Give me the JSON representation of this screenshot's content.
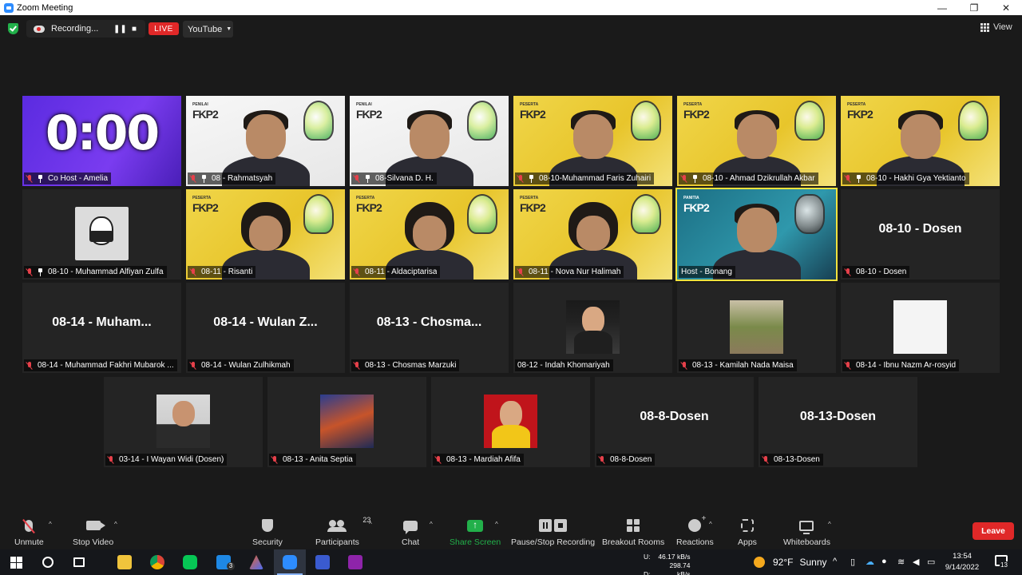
{
  "window": {
    "title": "Zoom Meeting",
    "controls": [
      "—",
      "❐",
      "✕"
    ]
  },
  "recording_bar": {
    "status": "Recording...",
    "live_label": "LIVE",
    "stream_target": "YouTube",
    "view_label": "View"
  },
  "timer": {
    "display": "0:00"
  },
  "tiles": [
    {
      "name": "Co Host - Amelia",
      "kind": "timer",
      "pinned": true
    },
    {
      "name": "08 - Rahmatsyah",
      "kind": "video",
      "bg": "white",
      "brand_top": "PENILAI",
      "pinned": true
    },
    {
      "name": "08-Silvana D. H.",
      "kind": "video",
      "bg": "white",
      "brand_top": "PENILAI",
      "pinned": true
    },
    {
      "name": "08-10-Muhammad Faris Zuhairi",
      "kind": "video",
      "bg": "yellow",
      "brand_top": "PESERTA",
      "pinned": true
    },
    {
      "name": "08-10 - Ahmad Dzikrullah Akbar",
      "kind": "video",
      "bg": "yellow",
      "brand_top": "PESERTA",
      "pinned": true
    },
    {
      "name": "08-10 - Hakhi Gya Yektianto",
      "kind": "video",
      "bg": "yellow",
      "brand_top": "PESERTA",
      "pinned": true
    },
    {
      "name": "08-10 - Muhammad Alfiyan Zulfa",
      "kind": "avatar",
      "pinned": true
    },
    {
      "name": "08-11 - Risanti",
      "kind": "video",
      "bg": "yellow",
      "brand_top": "PESERTA",
      "hijab": true
    },
    {
      "name": "08-11 - Aldaciptarisa",
      "kind": "video",
      "bg": "yellow",
      "brand_top": "PESERTA",
      "hijab": true
    },
    {
      "name": "08-11 - Nova Nur Halimah",
      "kind": "video",
      "bg": "yellow",
      "brand_top": "PESERTA",
      "hijab": true
    },
    {
      "name": "Host - Bonang",
      "kind": "video",
      "bg": "teal",
      "brand_top": "PANITIA",
      "highlight": true,
      "muted": false
    },
    {
      "name": "08-10 - Dosen",
      "kind": "text",
      "big": "08-10 - Dosen"
    },
    {
      "name": "08-14 - Muhammad Fakhri Mubarok ...",
      "kind": "text",
      "big": "08-14 - Muham..."
    },
    {
      "name": "08-14 - Wulan Zulhikmah",
      "kind": "text",
      "big": "08-14 - Wulan Z..."
    },
    {
      "name": "08-13 - Chosmas Marzuki",
      "kind": "text",
      "big": "08-13 - Chosma..."
    },
    {
      "name": "08-12 - Indah Khomariyah",
      "kind": "avatar",
      "muted": false
    },
    {
      "name": "08-13 - Kamilah Nada Maisa",
      "kind": "avatar"
    },
    {
      "name": "08-14 - Ibnu Nazm Ar-rosyid",
      "kind": "avatar"
    },
    {
      "name": "03-14 - I Wayan Widi (Dosen)",
      "kind": "avatar"
    },
    {
      "name": "08-13 - Anita Septia",
      "kind": "avatar"
    },
    {
      "name": "08-13 - Mardiah Afifa",
      "kind": "avatar"
    },
    {
      "name": "08-8-Dosen",
      "kind": "text",
      "big": "08-8-Dosen"
    },
    {
      "name": "08-13-Dosen",
      "kind": "text",
      "big": "08-13-Dosen"
    }
  ],
  "tile_brand": "FKP2",
  "toolbar": {
    "unmute": "Unmute",
    "stop_video": "Stop Video",
    "security": "Security",
    "participants": "Participants",
    "participants_count": "23",
    "chat": "Chat",
    "share_screen": "Share Screen",
    "pause_stop_recording": "Pause/Stop Recording",
    "breakout_rooms": "Breakout Rooms",
    "reactions": "Reactions",
    "apps": "Apps",
    "whiteboards": "Whiteboards",
    "leave": "Leave"
  },
  "taskbar": {
    "upload_label": "U:",
    "upload_value": "46.17 kB/s",
    "download_label": "D:",
    "download_value": "298.74 kB/s",
    "weather_temp": "92°F",
    "weather_desc": "Sunny",
    "time": "13:54",
    "date": "9/14/2022",
    "notification_count": "13",
    "mail_badge": "3"
  },
  "colors": {
    "accent_red": "#e02828",
    "share_green": "#22b04a",
    "highlight_yellow": "#f2e33d",
    "bg": "#1a1a1a",
    "tile": "#242424"
  }
}
